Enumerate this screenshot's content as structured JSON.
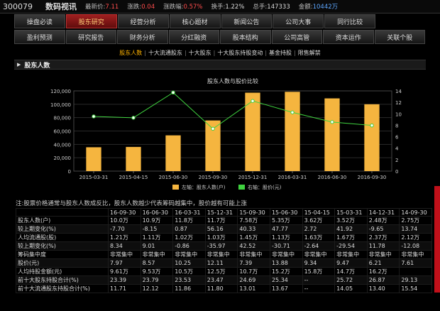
{
  "header": {
    "code": "300079",
    "name": "数码视讯",
    "quotes": [
      {
        "label": "最新价:",
        "value": "7.11",
        "color": "up"
      },
      {
        "label": "涨跌:",
        "value": "0.04",
        "color": "up"
      },
      {
        "label": "涨跌幅:",
        "value": "0.57%",
        "color": "up"
      },
      {
        "label": "换手:",
        "value": "1.22%",
        "color": "plain"
      },
      {
        "label": "总手:",
        "value": "147333",
        "color": "plain"
      },
      {
        "label": "金额:",
        "value": "10442万",
        "color": "blue"
      }
    ]
  },
  "nav": {
    "rows": [
      [
        "操盘必读",
        "股东研究",
        "经营分析",
        "核心题材",
        "新闻公告",
        "公司大事",
        "同行比较"
      ],
      [
        "盈利预测",
        "研究报告",
        "财务分析",
        "分红融资",
        "股本结构",
        "公司高管",
        "资本运作",
        "关联个股"
      ]
    ],
    "active": "股东研究"
  },
  "subnav": {
    "items": [
      "股东人数",
      "十大流通股东",
      "十大股东",
      "十大股东持股变动",
      "基金持股",
      "限售解禁"
    ],
    "active": "股东人数"
  },
  "section": {
    "title": "股东人数"
  },
  "chart_data": {
    "type": "bar",
    "title": "股东人数与股价比较",
    "categories": [
      "2015-03-31",
      "2015-04-15",
      "2015-06-30",
      "2015-09-30",
      "2015-12-31",
      "2016-03-31",
      "2016-06-30",
      "2016-09-30"
    ],
    "series": [
      {
        "name": "左轴：股东人数(户)",
        "kind": "bar",
        "axis": "left",
        "color": "#f5b53f",
        "values": [
          35700,
          36200,
          53500,
          75800,
          117300,
          118600,
          108800,
          100000
        ]
      },
      {
        "name": "右轴：股价(元)",
        "kind": "line",
        "axis": "right",
        "color": "#3fd23f",
        "values": [
          9.54,
          9.31,
          13.71,
          7.39,
          12.24,
          10.25,
          8.57,
          7.97
        ]
      }
    ],
    "ylim_left": [
      0,
      120000
    ],
    "yticks_left": [
      "0",
      "20,000",
      "40,000",
      "60,000",
      "80,000",
      "100,000",
      "120,000"
    ],
    "ylim_right": [
      0,
      14
    ],
    "yticks_right": [
      "0",
      "2",
      "4",
      "6",
      "8",
      "10",
      "12",
      "14"
    ],
    "legend_position": "bottom",
    "grid": true
  },
  "note": "注:股票价格通常与股东人数成反比，股东人数越少代表筹码越集中，股价越有可能上涨",
  "table": {
    "columns": [
      "",
      "16-09-30",
      "16-06-30",
      "16-03-31",
      "15-12-31",
      "15-09-30",
      "15-06-30",
      "15-04-15",
      "15-03-31",
      "14-12-31",
      "14-09-30"
    ],
    "rows": [
      [
        "股东人数(户)",
        "10.0万",
        "10.9万",
        "11.8万",
        "11.7万",
        "7.58万",
        "5.35万",
        "3.62万",
        "3.52万",
        "2.48万",
        "2.75万"
      ],
      [
        "较上期变化(%)",
        "-7.70",
        "-8.15",
        "0.87",
        "56.16",
        "40.33",
        "47.77",
        "2.72",
        "41.92",
        "-9.65",
        "13.74"
      ],
      [
        "人均流通股(股)",
        "1.21万",
        "1.11万",
        "1.02万",
        "1.03万",
        "1.45万",
        "1.13万",
        "1.63万",
        "1.67万",
        "2.37万",
        "2.12万"
      ],
      [
        "较上期变化(%)",
        "8.34",
        "9.01",
        "-0.86",
        "-35.97",
        "42.52",
        "-30.71",
        "-2.64",
        "-29.54",
        "11.78",
        "-12.08"
      ],
      [
        "筹码集中度",
        "非常集中",
        "非常集中",
        "非常集中",
        "非常集中",
        "非常集中",
        "非常集中",
        "非常集中",
        "非常集中",
        "非常集中",
        "非常集中"
      ],
      [
        "股价(元)",
        "7.97",
        "8.57",
        "10.25",
        "12.11",
        "7.39",
        "13.88",
        "9.34",
        "9.47",
        "6.21",
        "7.61"
      ],
      [
        "人均持股金额(元)",
        "9.61万",
        "9.53万",
        "10.5万",
        "12.5万",
        "10.7万",
        "15.2万",
        "15.8万",
        "14.7万",
        "16.2万",
        ""
      ],
      [
        "前十大股东持股合计(%)",
        "23.39",
        "23.79",
        "23.53",
        "23.47",
        "24.69",
        "25.34",
        "--",
        "25.72",
        "26.87",
        "29.13"
      ],
      [
        "前十大流通股东持股合计(%)",
        "11.71",
        "12.12",
        "11.86",
        "11.80",
        "13.01",
        "13.67",
        "--",
        "14.05",
        "13.40",
        "15.54"
      ]
    ]
  }
}
